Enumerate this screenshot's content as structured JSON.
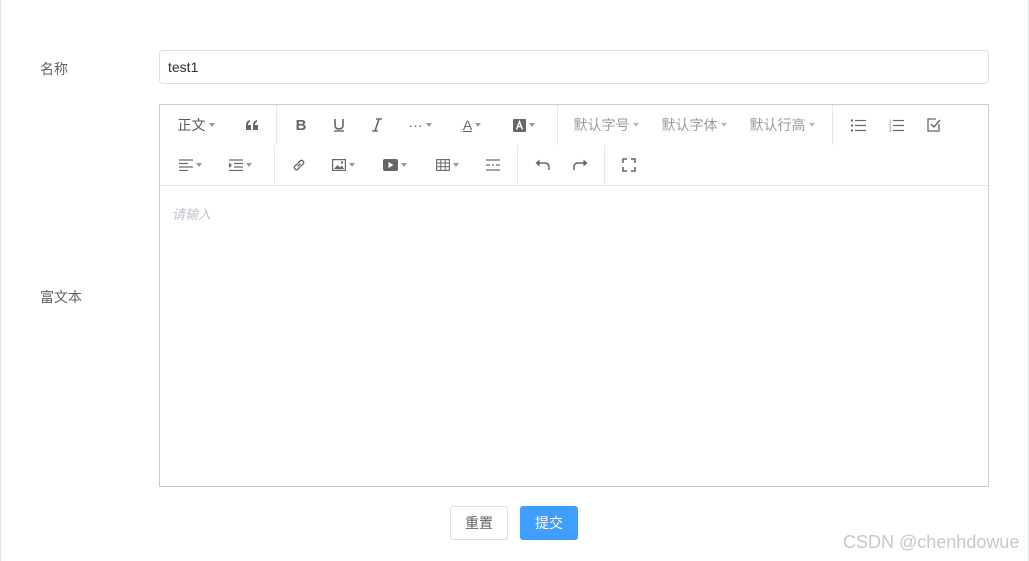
{
  "form": {
    "name_label": "名称",
    "name_value": "test1",
    "rich_label": "富文本"
  },
  "toolbar": {
    "paragraph": "正文",
    "font_size": "默认字号",
    "font_family": "默认字体",
    "line_height": "默认行高",
    "bold": "B",
    "more": "···",
    "font_color": "A"
  },
  "editor": {
    "placeholder": "请输入"
  },
  "buttons": {
    "reset": "重置",
    "submit": "提交"
  },
  "watermark": "CSDN @chenhdowue"
}
